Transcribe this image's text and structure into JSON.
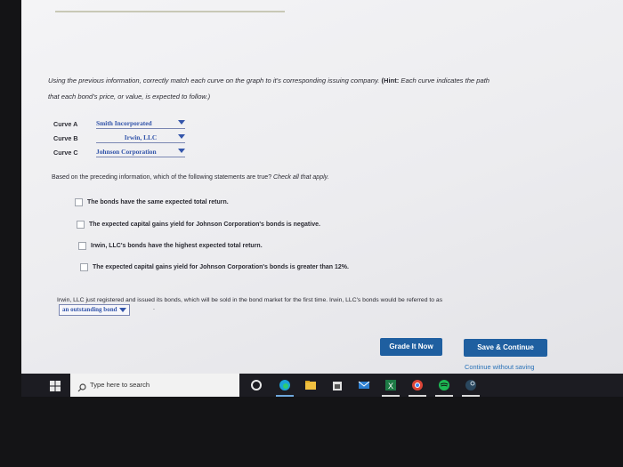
{
  "question": {
    "text_line1": "Using the previous information, correctly match each curve on the graph to it's corresponding issuing company.",
    "hint_label": "(Hint:",
    "hint_text": "Each curve indicates the path",
    "text_line2": "that each bond's price, or value, is expected to follow.)"
  },
  "curves": [
    {
      "label": "Curve A",
      "selected": "Smith Incorporated"
    },
    {
      "label": "Curve B",
      "selected": "Irwin, LLC"
    },
    {
      "label": "Curve C",
      "selected": "Johnson Corporation"
    }
  ],
  "statements": {
    "prompt": "Based on the preceding information, which of the following statements are true?",
    "prompt_italic": "Check all that apply.",
    "options": [
      "The bonds have the same expected total return.",
      "The expected capital gains yield for Johnson Corporation's bonds is negative.",
      "Irwin, LLC's bonds have the highest expected total return.",
      "The expected capital gains yield for Johnson Corporation's bonds is greater than 12%."
    ]
  },
  "registration": {
    "text": "Irwin, LLC just registered and issued its bonds, which will be sold in the bond market for the first time. Irwin, LLC's bonds would be referred to as",
    "selected": "an outstanding bond",
    "trailing": "."
  },
  "buttons": {
    "grade": "Grade It Now",
    "save": "Save & Continue",
    "continue_link": "Continue without saving"
  },
  "taskbar": {
    "search_placeholder": "Type here to search",
    "icons": [
      "windows-start-icon",
      "cortana-icon",
      "edge-browser-icon",
      "file-explorer-icon",
      "store-icon",
      "mail-icon",
      "excel-icon",
      "chrome-icon",
      "spotify-icon",
      "steam-icon"
    ]
  },
  "colors": {
    "accent": "#1f5fa0",
    "link": "#2a72b8",
    "dropdown_text": "#3355aa"
  }
}
